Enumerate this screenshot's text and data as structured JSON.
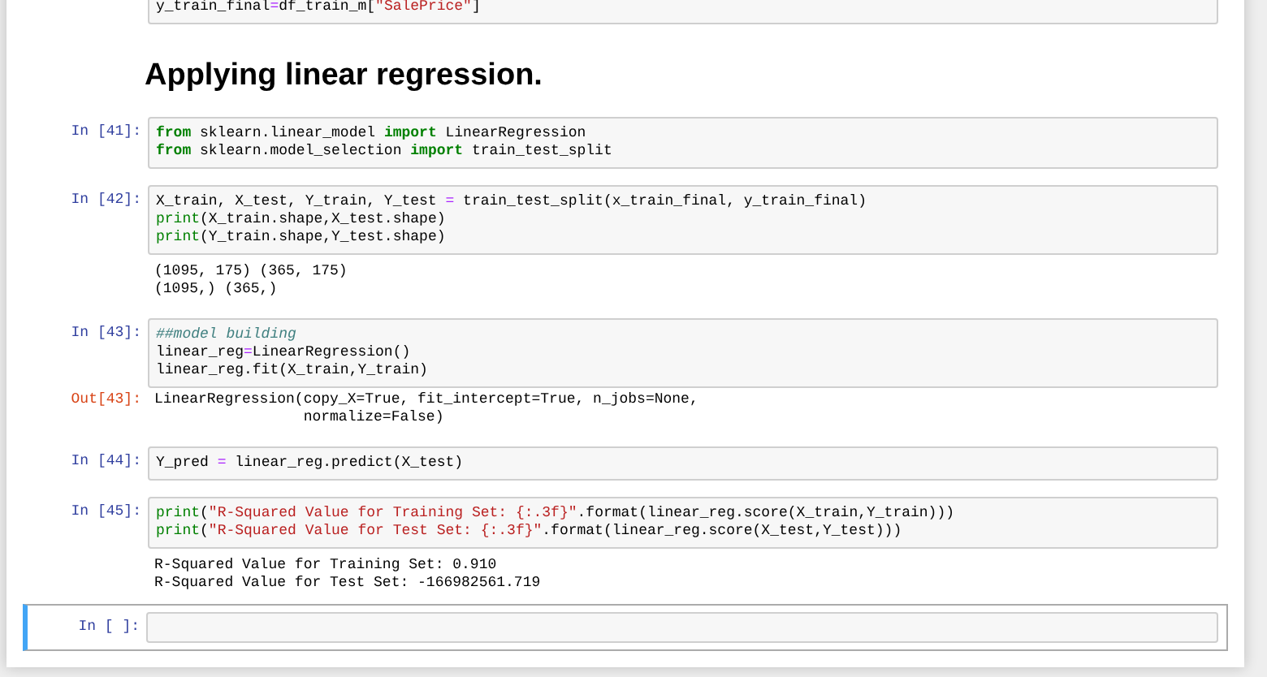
{
  "top_cell": {
    "lines": [
      [
        {
          "text": "y_train_final",
          "kind": "plain"
        },
        {
          "text": "=",
          "kind": "op"
        },
        {
          "text": "df_train_m[",
          "kind": "plain"
        },
        {
          "text": "\"SalePrice\"",
          "kind": "str"
        },
        {
          "text": "]",
          "kind": "plain"
        }
      ]
    ]
  },
  "heading": "Applying linear regression.",
  "cells": [
    {
      "prompt": "In [41]:",
      "selected": false,
      "lines": [
        [
          {
            "text": "from",
            "kind": "kw"
          },
          {
            "text": " sklearn.linear_model ",
            "kind": "plain"
          },
          {
            "text": "import",
            "kind": "kw"
          },
          {
            "text": " LinearRegression",
            "kind": "plain"
          }
        ],
        [
          {
            "text": "from",
            "kind": "kw"
          },
          {
            "text": " sklearn.model_selection ",
            "kind": "plain"
          },
          {
            "text": "import",
            "kind": "kw"
          },
          {
            "text": " train_test_split",
            "kind": "plain"
          }
        ]
      ]
    },
    {
      "prompt": "In [42]:",
      "selected": false,
      "lines": [
        [
          {
            "text": "X_train, X_test, Y_train, Y_test ",
            "kind": "plain"
          },
          {
            "text": "=",
            "kind": "op"
          },
          {
            "text": " train_test_split(x_train_final, y_train_final)",
            "kind": "plain"
          }
        ],
        [
          {
            "text": "print",
            "kind": "builtin"
          },
          {
            "text": "(X_train.shape,X_test.shape)",
            "kind": "plain"
          }
        ],
        [
          {
            "text": "print",
            "kind": "builtin"
          },
          {
            "text": "(Y_train.shape,Y_test.shape)",
            "kind": "plain"
          }
        ]
      ],
      "output": {
        "lines": [
          "(1095, 175) (365, 175)",
          "(1095,) (365,)"
        ]
      }
    },
    {
      "prompt": "In [43]:",
      "selected": false,
      "lines": [
        [
          {
            "text": "##model building",
            "kind": "comment"
          }
        ],
        [
          {
            "text": "linear_reg",
            "kind": "plain"
          },
          {
            "text": "=",
            "kind": "op"
          },
          {
            "text": "LinearRegression()",
            "kind": "plain"
          }
        ],
        [
          {
            "text": "linear_reg.fit(X_train,Y_train)",
            "kind": "plain"
          }
        ]
      ],
      "output": {
        "prompt": "Out[43]:",
        "lines": [
          "LinearRegression(copy_X=True, fit_intercept=True, n_jobs=None,",
          "                 normalize=False)"
        ]
      }
    },
    {
      "prompt": "In [44]:",
      "selected": false,
      "lines": [
        [
          {
            "text": "Y_pred ",
            "kind": "plain"
          },
          {
            "text": "=",
            "kind": "op"
          },
          {
            "text": " linear_reg.predict(X_test)",
            "kind": "plain"
          }
        ]
      ]
    },
    {
      "prompt": "In [45]:",
      "selected": false,
      "lines": [
        [
          {
            "text": "print",
            "kind": "builtin"
          },
          {
            "text": "(",
            "kind": "plain"
          },
          {
            "text": "\"R-Squared Value for Training Set: {:.3f}\"",
            "kind": "str"
          },
          {
            "text": ".format(linear_reg.score(X_train,Y_train)))",
            "kind": "plain"
          }
        ],
        [
          {
            "text": "print",
            "kind": "builtin"
          },
          {
            "text": "(",
            "kind": "plain"
          },
          {
            "text": "\"R-Squared Value for Test Set: {:.3f}\"",
            "kind": "str"
          },
          {
            "text": ".format(linear_reg.score(X_test,Y_test)))",
            "kind": "plain"
          }
        ]
      ],
      "output": {
        "lines": [
          "R-Squared Value for Training Set: 0.910",
          "R-Squared Value for Test Set: -166982561.719"
        ]
      }
    },
    {
      "prompt": "In [ ]:",
      "selected": true
    }
  ]
}
